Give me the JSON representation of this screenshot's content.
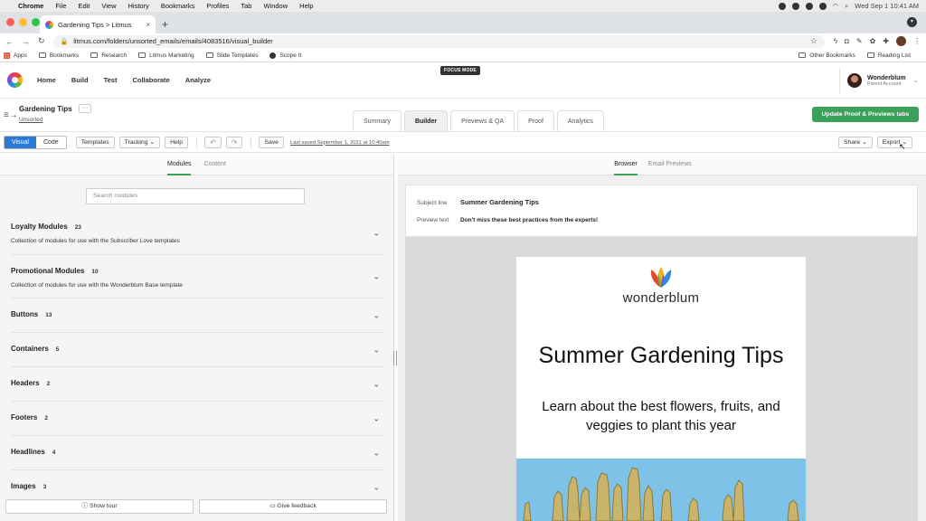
{
  "mac_menubar": {
    "items": [
      "Chrome",
      "File",
      "Edit",
      "View",
      "History",
      "Bookmarks",
      "Profiles",
      "Tab",
      "Window",
      "Help"
    ],
    "clock": "Wed Sep 1  10:41 AM"
  },
  "browser": {
    "tab_title": "Gardening Tips > Litmus",
    "url": "litmus.com/folders/unsorted_emails/emails/4083516/visual_builder",
    "bookmarks": [
      "Apps",
      "Bookmarks",
      "Research",
      "Litmus Marketing",
      "Slide Templates",
      "Scope It"
    ],
    "bookmarks_right": [
      "Other Bookmarks",
      "Reading List"
    ]
  },
  "focus_mode": "FOCUS MODE",
  "app_nav": {
    "links": [
      "Home",
      "Build",
      "Test",
      "Collaborate",
      "Analyze"
    ],
    "account_name": "Wonderblum",
    "account_role": "Parent Account"
  },
  "project": {
    "title": "Gardening Tips",
    "folder": "Unsorted",
    "more": "···",
    "tabs": [
      "Summary",
      "Builder",
      "Previews & QA",
      "Proof",
      "Analytics"
    ],
    "active_tab": "Builder",
    "update_button": "Update Proof & Previews tabs"
  },
  "toolbar": {
    "visual": "Visual",
    "code": "Code",
    "templates": "Templates",
    "tracking": "Tracking",
    "help": "Help",
    "save": "Save",
    "last_saved": "Last saved September 1, 2021 at 10:40am",
    "share": "Share",
    "export": "Export"
  },
  "left_panel": {
    "tabs": [
      "Modules",
      "Content"
    ],
    "search_placeholder": "Search modules",
    "modules": [
      {
        "title": "Loyalty Modules",
        "count": "23",
        "desc": "Collection of modules for use with the Subscriber Love templates"
      },
      {
        "title": "Promotional Modules",
        "count": "10",
        "desc": "Collection of modules for use with the Wonderblum Base template"
      },
      {
        "title": "Buttons",
        "count": "13",
        "desc": ""
      },
      {
        "title": "Containers",
        "count": "5",
        "desc": ""
      },
      {
        "title": "Headers",
        "count": "2",
        "desc": ""
      },
      {
        "title": "Footers",
        "count": "2",
        "desc": ""
      },
      {
        "title": "Headlines",
        "count": "4",
        "desc": ""
      },
      {
        "title": "Images",
        "count": "3",
        "desc": ""
      }
    ],
    "show_tour": "Show tour",
    "give_feedback": "Give feedback"
  },
  "right_panel": {
    "tabs": [
      "Browser",
      "Email Previews"
    ],
    "subject_label": "Subject line",
    "subject_value": "Summer Gardening Tips",
    "preview_label": "Preview text",
    "preview_value": "Don't miss these best practices from the experts!",
    "email": {
      "brand": "wonderblum",
      "headline": "Summer Gardening Tips",
      "subhead": "Learn about the best flowers, fruits, and veggies to plant this year"
    }
  },
  "colors": {
    "accent_blue": "#2b79d4",
    "accent_green": "#3aa05a"
  }
}
